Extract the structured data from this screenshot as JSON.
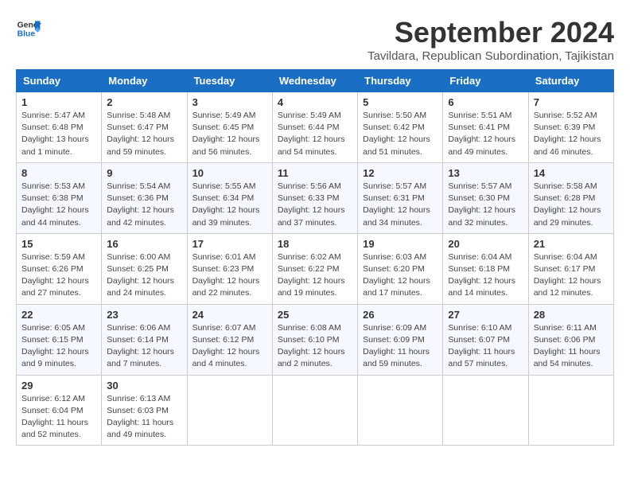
{
  "logo": {
    "line1": "General",
    "line2": "Blue"
  },
  "title": "September 2024",
  "subtitle": "Tavildara, Republican Subordination, Tajikistan",
  "weekdays": [
    "Sunday",
    "Monday",
    "Tuesday",
    "Wednesday",
    "Thursday",
    "Friday",
    "Saturday"
  ],
  "weeks": [
    [
      {
        "day": "1",
        "info": "Sunrise: 5:47 AM\nSunset: 6:48 PM\nDaylight: 13 hours\nand 1 minute."
      },
      {
        "day": "2",
        "info": "Sunrise: 5:48 AM\nSunset: 6:47 PM\nDaylight: 12 hours\nand 59 minutes."
      },
      {
        "day": "3",
        "info": "Sunrise: 5:49 AM\nSunset: 6:45 PM\nDaylight: 12 hours\nand 56 minutes."
      },
      {
        "day": "4",
        "info": "Sunrise: 5:49 AM\nSunset: 6:44 PM\nDaylight: 12 hours\nand 54 minutes."
      },
      {
        "day": "5",
        "info": "Sunrise: 5:50 AM\nSunset: 6:42 PM\nDaylight: 12 hours\nand 51 minutes."
      },
      {
        "day": "6",
        "info": "Sunrise: 5:51 AM\nSunset: 6:41 PM\nDaylight: 12 hours\nand 49 minutes."
      },
      {
        "day": "7",
        "info": "Sunrise: 5:52 AM\nSunset: 6:39 PM\nDaylight: 12 hours\nand 46 minutes."
      }
    ],
    [
      {
        "day": "8",
        "info": "Sunrise: 5:53 AM\nSunset: 6:38 PM\nDaylight: 12 hours\nand 44 minutes."
      },
      {
        "day": "9",
        "info": "Sunrise: 5:54 AM\nSunset: 6:36 PM\nDaylight: 12 hours\nand 42 minutes."
      },
      {
        "day": "10",
        "info": "Sunrise: 5:55 AM\nSunset: 6:34 PM\nDaylight: 12 hours\nand 39 minutes."
      },
      {
        "day": "11",
        "info": "Sunrise: 5:56 AM\nSunset: 6:33 PM\nDaylight: 12 hours\nand 37 minutes."
      },
      {
        "day": "12",
        "info": "Sunrise: 5:57 AM\nSunset: 6:31 PM\nDaylight: 12 hours\nand 34 minutes."
      },
      {
        "day": "13",
        "info": "Sunrise: 5:57 AM\nSunset: 6:30 PM\nDaylight: 12 hours\nand 32 minutes."
      },
      {
        "day": "14",
        "info": "Sunrise: 5:58 AM\nSunset: 6:28 PM\nDaylight: 12 hours\nand 29 minutes."
      }
    ],
    [
      {
        "day": "15",
        "info": "Sunrise: 5:59 AM\nSunset: 6:26 PM\nDaylight: 12 hours\nand 27 minutes."
      },
      {
        "day": "16",
        "info": "Sunrise: 6:00 AM\nSunset: 6:25 PM\nDaylight: 12 hours\nand 24 minutes."
      },
      {
        "day": "17",
        "info": "Sunrise: 6:01 AM\nSunset: 6:23 PM\nDaylight: 12 hours\nand 22 minutes."
      },
      {
        "day": "18",
        "info": "Sunrise: 6:02 AM\nSunset: 6:22 PM\nDaylight: 12 hours\nand 19 minutes."
      },
      {
        "day": "19",
        "info": "Sunrise: 6:03 AM\nSunset: 6:20 PM\nDaylight: 12 hours\nand 17 minutes."
      },
      {
        "day": "20",
        "info": "Sunrise: 6:04 AM\nSunset: 6:18 PM\nDaylight: 12 hours\nand 14 minutes."
      },
      {
        "day": "21",
        "info": "Sunrise: 6:04 AM\nSunset: 6:17 PM\nDaylight: 12 hours\nand 12 minutes."
      }
    ],
    [
      {
        "day": "22",
        "info": "Sunrise: 6:05 AM\nSunset: 6:15 PM\nDaylight: 12 hours\nand 9 minutes."
      },
      {
        "day": "23",
        "info": "Sunrise: 6:06 AM\nSunset: 6:14 PM\nDaylight: 12 hours\nand 7 minutes."
      },
      {
        "day": "24",
        "info": "Sunrise: 6:07 AM\nSunset: 6:12 PM\nDaylight: 12 hours\nand 4 minutes."
      },
      {
        "day": "25",
        "info": "Sunrise: 6:08 AM\nSunset: 6:10 PM\nDaylight: 12 hours\nand 2 minutes."
      },
      {
        "day": "26",
        "info": "Sunrise: 6:09 AM\nSunset: 6:09 PM\nDaylight: 11 hours\nand 59 minutes."
      },
      {
        "day": "27",
        "info": "Sunrise: 6:10 AM\nSunset: 6:07 PM\nDaylight: 11 hours\nand 57 minutes."
      },
      {
        "day": "28",
        "info": "Sunrise: 6:11 AM\nSunset: 6:06 PM\nDaylight: 11 hours\nand 54 minutes."
      }
    ],
    [
      {
        "day": "29",
        "info": "Sunrise: 6:12 AM\nSunset: 6:04 PM\nDaylight: 11 hours\nand 52 minutes."
      },
      {
        "day": "30",
        "info": "Sunrise: 6:13 AM\nSunset: 6:03 PM\nDaylight: 11 hours\nand 49 minutes."
      },
      {
        "day": "",
        "info": ""
      },
      {
        "day": "",
        "info": ""
      },
      {
        "day": "",
        "info": ""
      },
      {
        "day": "",
        "info": ""
      },
      {
        "day": "",
        "info": ""
      }
    ]
  ]
}
